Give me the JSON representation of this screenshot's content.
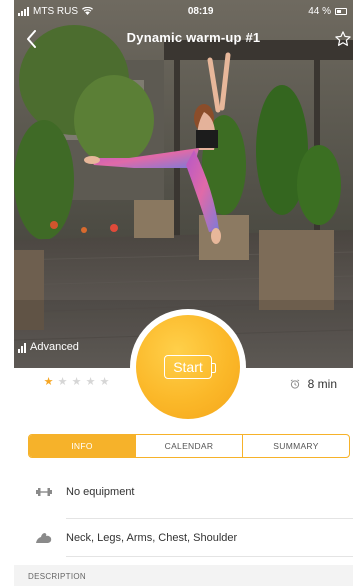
{
  "status_bar": {
    "carrier": "MTS RUS",
    "time": "08:19",
    "battery": "44 %"
  },
  "header": {
    "title": "Dynamic warm-up #1"
  },
  "workout": {
    "level": "Advanced",
    "start_label": "Start",
    "rating_value": 1,
    "rating_max": 5,
    "duration": "8 min"
  },
  "tabs": [
    {
      "label": "INFO",
      "active": true
    },
    {
      "label": "CALENDAR",
      "active": false
    },
    {
      "label": "SUMMARY",
      "active": false
    }
  ],
  "info": {
    "equipment": "No equipment",
    "muscles": "Neck, Legs, Arms, Chest, Shoulder"
  },
  "description_header": "DESCRIPTION",
  "colors": {
    "accent": "#f6b22a",
    "star_filled": "#f6a623",
    "star_empty": "#d6d6d6",
    "icon_gray": "#8a8a8a"
  }
}
